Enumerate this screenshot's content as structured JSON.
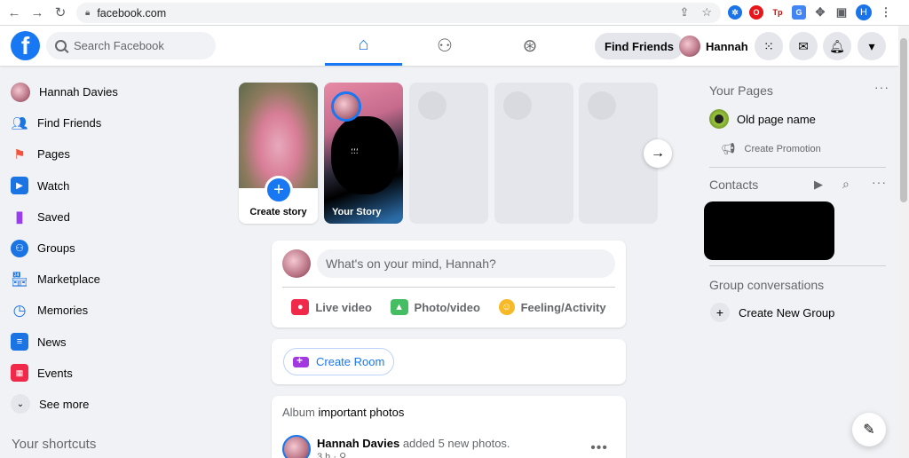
{
  "browser": {
    "url": "facebook.com",
    "profile_initial": "H"
  },
  "topbar": {
    "search_placeholder": "Search Facebook",
    "find_friends": "Find Friends",
    "user_name": "Hannah"
  },
  "sidebar": {
    "items": [
      {
        "label": "Hannah Davies",
        "icon": "avatar"
      },
      {
        "label": "Find Friends",
        "icon": "friends-icon",
        "color": "#1b74e4"
      },
      {
        "label": "Pages",
        "icon": "flag-icon",
        "color": "#f5533d"
      },
      {
        "label": "Watch",
        "icon": "watch-icon",
        "color": "#1b74e4"
      },
      {
        "label": "Saved",
        "icon": "bookmark-icon",
        "color": "#9a3cf0"
      },
      {
        "label": "Groups",
        "icon": "groups-icon",
        "color": "#1b74e4"
      },
      {
        "label": "Marketplace",
        "icon": "store-icon",
        "color": "#1b74e4"
      },
      {
        "label": "Memories",
        "icon": "clock-icon",
        "color": "#1b74e4"
      },
      {
        "label": "News",
        "icon": "news-icon",
        "color": "#1b74e4"
      },
      {
        "label": "Events",
        "icon": "calendar-icon",
        "color": "#f02849"
      },
      {
        "label": "See more",
        "icon": "chevron-down-icon"
      }
    ],
    "shortcuts_title": "Your shortcuts"
  },
  "stories": {
    "create_label": "Create story",
    "your_story_label": "Your Story"
  },
  "composer": {
    "placeholder": "What's on your mind, Hannah?",
    "live_video": "Live video",
    "photo_video": "Photo/video",
    "feeling": "Feeling/Activity"
  },
  "room": {
    "label": "Create Room"
  },
  "post": {
    "album_prefix": "Album",
    "album_name": "important photos",
    "author": "Hannah Davies",
    "action": "added 5 new photos.",
    "meta": "3 h · ⚲"
  },
  "right_rail": {
    "pages_title": "Your Pages",
    "page_name": "Old page name",
    "create_promotion": "Create Promotion",
    "contacts_title": "Contacts",
    "group_conversations_title": "Group conversations",
    "create_group": "Create New Group"
  },
  "colors": {
    "accent": "#1877f2",
    "background": "#f0f2f5"
  }
}
